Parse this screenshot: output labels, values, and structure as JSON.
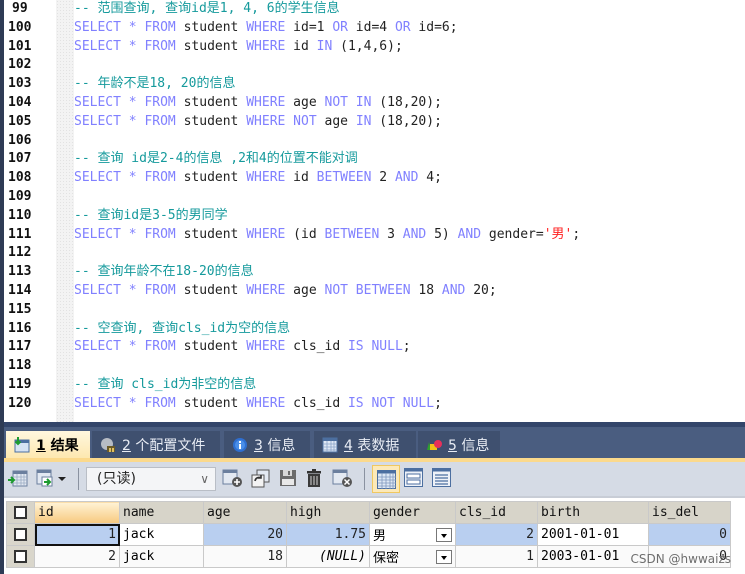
{
  "editor": {
    "lines": [
      {
        "n": "99",
        "tokens": [
          {
            "t": "cm",
            "v": "-- 范围查询, 查询id是1, 4, 6的学生信息"
          }
        ]
      },
      {
        "n": "100",
        "tokens": [
          {
            "t": "kw",
            "v": "SELECT"
          },
          {
            "t": "id",
            "v": " "
          },
          {
            "t": "kw",
            "v": "*"
          },
          {
            "t": "id",
            "v": " "
          },
          {
            "t": "kw",
            "v": "FROM"
          },
          {
            "t": "id",
            "v": " student "
          },
          {
            "t": "kw",
            "v": "WHERE"
          },
          {
            "t": "id",
            "v": " id=1 "
          },
          {
            "t": "kw",
            "v": "OR"
          },
          {
            "t": "id",
            "v": " id=4 "
          },
          {
            "t": "kw",
            "v": "OR"
          },
          {
            "t": "id",
            "v": " id=6;"
          }
        ]
      },
      {
        "n": "101",
        "tokens": [
          {
            "t": "kw",
            "v": "SELECT"
          },
          {
            "t": "id",
            "v": " "
          },
          {
            "t": "kw",
            "v": "*"
          },
          {
            "t": "id",
            "v": " "
          },
          {
            "t": "kw",
            "v": "FROM"
          },
          {
            "t": "id",
            "v": " student "
          },
          {
            "t": "kw",
            "v": "WHERE"
          },
          {
            "t": "id",
            "v": " id "
          },
          {
            "t": "kw",
            "v": "IN"
          },
          {
            "t": "id",
            "v": " (1,4,6);"
          }
        ]
      },
      {
        "n": "102",
        "tokens": []
      },
      {
        "n": "103",
        "tokens": [
          {
            "t": "cm",
            "v": "-- 年龄不是18, 20的信息"
          }
        ]
      },
      {
        "n": "104",
        "tokens": [
          {
            "t": "kw",
            "v": "SELECT"
          },
          {
            "t": "id",
            "v": " "
          },
          {
            "t": "kw",
            "v": "*"
          },
          {
            "t": "id",
            "v": " "
          },
          {
            "t": "kw",
            "v": "FROM"
          },
          {
            "t": "id",
            "v": " student "
          },
          {
            "t": "kw",
            "v": "WHERE"
          },
          {
            "t": "id",
            "v": " age "
          },
          {
            "t": "kw",
            "v": "NOT IN"
          },
          {
            "t": "id",
            "v": " (18,20);"
          }
        ]
      },
      {
        "n": "105",
        "tokens": [
          {
            "t": "kw",
            "v": "SELECT"
          },
          {
            "t": "id",
            "v": " "
          },
          {
            "t": "kw",
            "v": "*"
          },
          {
            "t": "id",
            "v": " "
          },
          {
            "t": "kw",
            "v": "FROM"
          },
          {
            "t": "id",
            "v": " student "
          },
          {
            "t": "kw",
            "v": "WHERE NOT"
          },
          {
            "t": "id",
            "v": " age "
          },
          {
            "t": "kw",
            "v": "IN"
          },
          {
            "t": "id",
            "v": " (18,20);"
          }
        ]
      },
      {
        "n": "106",
        "tokens": []
      },
      {
        "n": "107",
        "tokens": [
          {
            "t": "cm",
            "v": "-- 查询 id是2-4的信息 ,2和4的位置不能对调"
          }
        ]
      },
      {
        "n": "108",
        "tokens": [
          {
            "t": "kw",
            "v": "SELECT"
          },
          {
            "t": "id",
            "v": " "
          },
          {
            "t": "kw",
            "v": "*"
          },
          {
            "t": "id",
            "v": " "
          },
          {
            "t": "kw",
            "v": "FROM"
          },
          {
            "t": "id",
            "v": " student "
          },
          {
            "t": "kw",
            "v": "WHERE"
          },
          {
            "t": "id",
            "v": " id "
          },
          {
            "t": "kw",
            "v": "BETWEEN"
          },
          {
            "t": "id",
            "v": " 2 "
          },
          {
            "t": "kw",
            "v": "AND"
          },
          {
            "t": "id",
            "v": " 4;"
          }
        ]
      },
      {
        "n": "109",
        "tokens": []
      },
      {
        "n": "110",
        "tokens": [
          {
            "t": "cm",
            "v": "-- 查询id是3-5的男同学"
          }
        ]
      },
      {
        "n": "111",
        "tokens": [
          {
            "t": "kw",
            "v": "SELECT"
          },
          {
            "t": "id",
            "v": " "
          },
          {
            "t": "kw",
            "v": "*"
          },
          {
            "t": "id",
            "v": " "
          },
          {
            "t": "kw",
            "v": "FROM"
          },
          {
            "t": "id",
            "v": " student "
          },
          {
            "t": "kw",
            "v": "WHERE"
          },
          {
            "t": "id",
            "v": " (id "
          },
          {
            "t": "kw",
            "v": "BETWEEN"
          },
          {
            "t": "id",
            "v": " 3 "
          },
          {
            "t": "kw",
            "v": "AND"
          },
          {
            "t": "id",
            "v": " 5) "
          },
          {
            "t": "kw",
            "v": "AND"
          },
          {
            "t": "id",
            "v": " gender="
          },
          {
            "t": "str",
            "v": "'男'"
          },
          {
            "t": "id",
            "v": ";"
          }
        ]
      },
      {
        "n": "112",
        "tokens": []
      },
      {
        "n": "113",
        "tokens": [
          {
            "t": "cm",
            "v": "-- 查询年龄不在18-20的信息"
          }
        ]
      },
      {
        "n": "114",
        "tokens": [
          {
            "t": "kw",
            "v": "SELECT"
          },
          {
            "t": "id",
            "v": " "
          },
          {
            "t": "kw",
            "v": "*"
          },
          {
            "t": "id",
            "v": " "
          },
          {
            "t": "kw",
            "v": "FROM"
          },
          {
            "t": "id",
            "v": " student "
          },
          {
            "t": "kw",
            "v": "WHERE"
          },
          {
            "t": "id",
            "v": " age "
          },
          {
            "t": "kw",
            "v": "NOT BETWEEN"
          },
          {
            "t": "id",
            "v": " 18 "
          },
          {
            "t": "kw",
            "v": "AND"
          },
          {
            "t": "id",
            "v": " 20;"
          }
        ]
      },
      {
        "n": "115",
        "tokens": []
      },
      {
        "n": "116",
        "tokens": [
          {
            "t": "cm",
            "v": "-- 空查询, 查询cls_id为空的信息"
          }
        ]
      },
      {
        "n": "117",
        "tokens": [
          {
            "t": "kw",
            "v": "SELECT"
          },
          {
            "t": "id",
            "v": " "
          },
          {
            "t": "kw",
            "v": "*"
          },
          {
            "t": "id",
            "v": " "
          },
          {
            "t": "kw",
            "v": "FROM"
          },
          {
            "t": "id",
            "v": " student "
          },
          {
            "t": "kw",
            "v": "WHERE"
          },
          {
            "t": "id",
            "v": " cls_id "
          },
          {
            "t": "kw",
            "v": "IS NULL"
          },
          {
            "t": "id",
            "v": ";"
          }
        ]
      },
      {
        "n": "118",
        "tokens": []
      },
      {
        "n": "119",
        "tokens": [
          {
            "t": "cm",
            "v": "-- 查询 cls_id为非空的信息"
          }
        ]
      },
      {
        "n": "120",
        "tokens": [
          {
            "t": "kw",
            "v": "SELECT"
          },
          {
            "t": "id",
            "v": " "
          },
          {
            "t": "kw",
            "v": "*"
          },
          {
            "t": "id",
            "v": " "
          },
          {
            "t": "kw",
            "v": "FROM"
          },
          {
            "t": "id",
            "v": " student "
          },
          {
            "t": "kw",
            "v": "WHERE"
          },
          {
            "t": "id",
            "v": " cls_id "
          },
          {
            "t": "kw",
            "v": "IS NOT NULL"
          },
          {
            "t": "id",
            "v": ";"
          }
        ]
      }
    ]
  },
  "tabs": [
    {
      "num": "1",
      "label": "结果",
      "icon": "result-table-icon",
      "active": true
    },
    {
      "num": "2",
      "label": "个配置文件",
      "icon": "profile-icon",
      "active": false
    },
    {
      "num": "3",
      "label": "信息",
      "icon": "info-icon",
      "active": false
    },
    {
      "num": "4",
      "label": "表数据",
      "icon": "table-data-icon",
      "active": false
    },
    {
      "num": "5",
      "label": "信息",
      "icon": "info-shapes-icon",
      "active": false
    }
  ],
  "toolbar": {
    "mode_select": "(只读)"
  },
  "grid": {
    "columns": [
      "id",
      "name",
      "age",
      "high",
      "gender",
      "cls_id",
      "birth",
      "is_del"
    ],
    "rows": [
      {
        "id": "1",
        "name": "jack",
        "age": "20",
        "high": "1.75",
        "gender": "男",
        "cls_id": "2",
        "birth": "2001-01-01",
        "is_del": "0"
      },
      {
        "id": "2",
        "name": "jack",
        "age": "18",
        "high": "(NULL)",
        "gender": "保密",
        "cls_id": "1",
        "birth": "2003-01-01",
        "is_del": "0"
      }
    ]
  },
  "watermark": "CSDN @hwwaizs",
  "colors": {
    "keyword": "#8080ff",
    "comment": "#159a9c",
    "string": "#ff2020",
    "tabbar": "#4a5d80",
    "selected_row": "#b9cff0"
  }
}
